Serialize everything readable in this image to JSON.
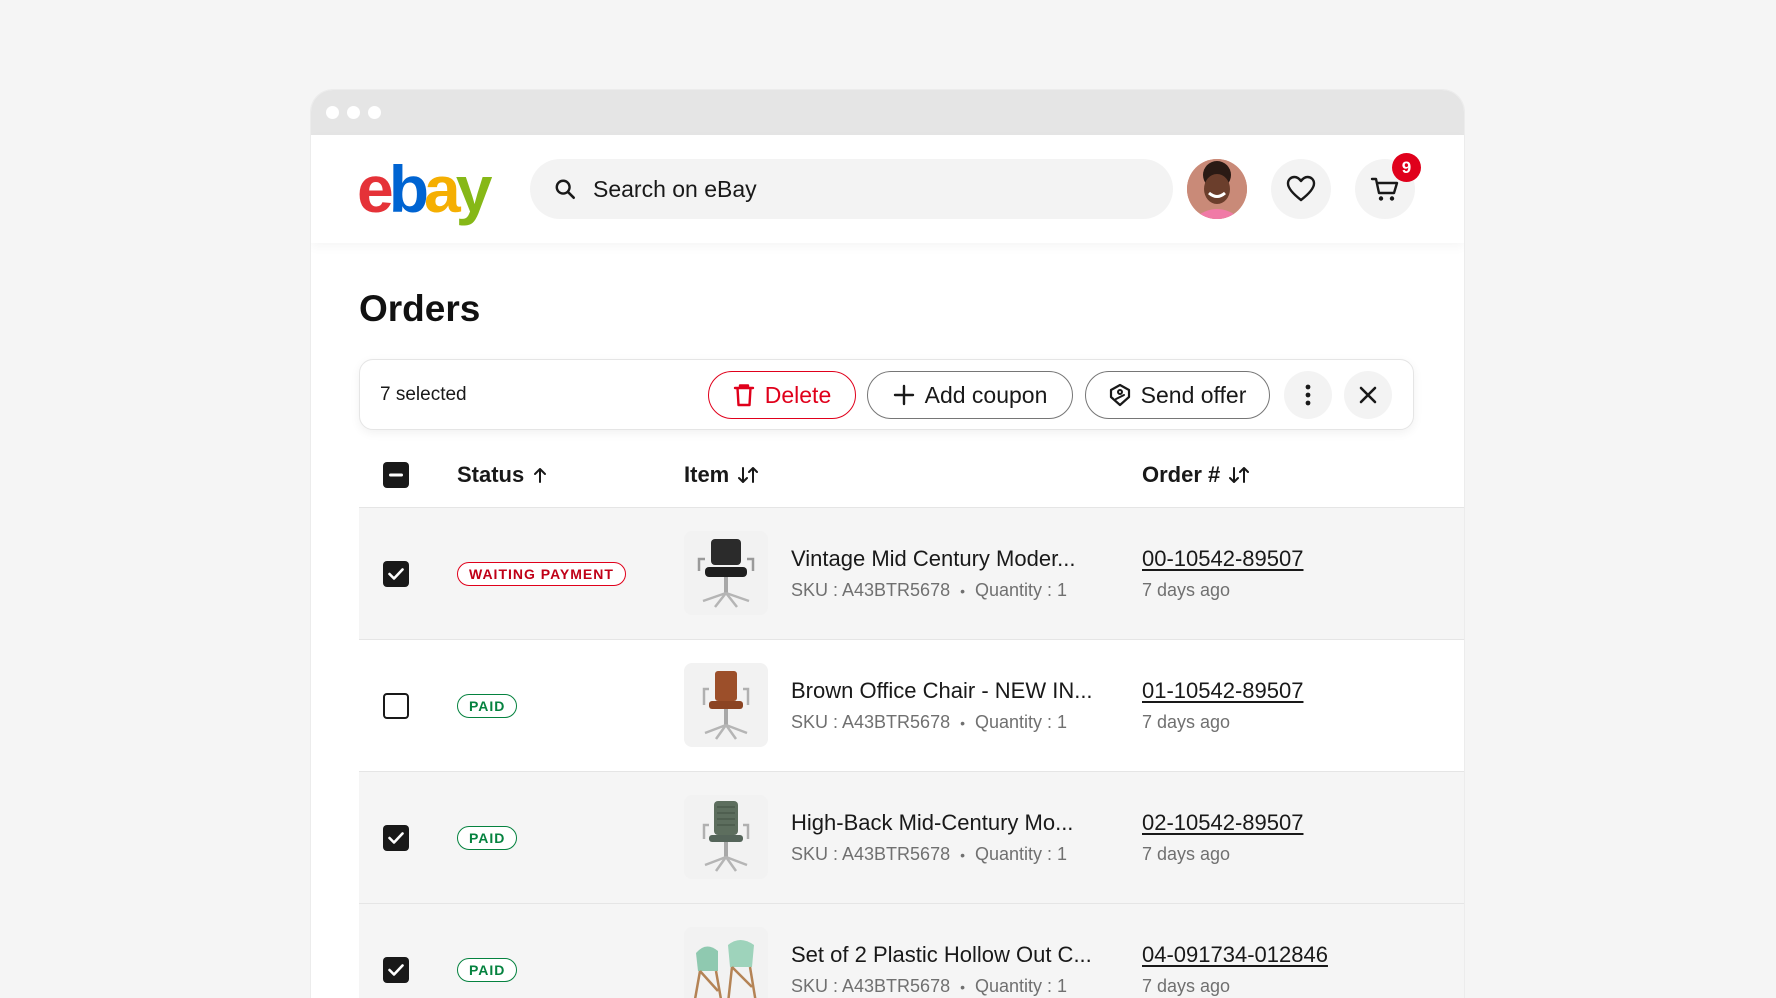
{
  "brand": {
    "logo_letters": [
      "e",
      "b",
      "a",
      "y"
    ],
    "logo_colors": [
      "#e53238",
      "#0064d2",
      "#f5af02",
      "#86b817"
    ]
  },
  "header": {
    "search_placeholder": "Search on eBay",
    "cart_count": "9"
  },
  "page": {
    "title": "Orders"
  },
  "action_bar": {
    "selected_label": "7 selected",
    "delete_label": "Delete",
    "add_coupon_label": "Add coupon",
    "send_offer_label": "Send offer"
  },
  "table": {
    "columns": {
      "status": "Status",
      "item": "Item",
      "order": "Order #"
    },
    "rows": [
      {
        "checked": true,
        "status": "WAITING PAYMENT",
        "status_type": "waiting",
        "title": "Vintage Mid Century Moder...",
        "sku": "SKU : A43BTR5678",
        "quantity": "Quantity : 1",
        "order_number": "00-10542-89507",
        "time": "7 days ago",
        "thumb_icon": "black-office-chair-image"
      },
      {
        "checked": false,
        "status": "PAID",
        "status_type": "paid",
        "title": "Brown Office Chair - NEW IN...",
        "sku": "SKU : A43BTR5678",
        "quantity": "Quantity : 1",
        "order_number": "01-10542-89507",
        "time": "7 days ago",
        "thumb_icon": "brown-office-chair-image"
      },
      {
        "checked": true,
        "status": "PAID",
        "status_type": "paid",
        "title": "High-Back Mid-Century Mo...",
        "sku": "SKU : A43BTR5678",
        "quantity": "Quantity : 1",
        "order_number": "02-10542-89507",
        "time": "7 days ago",
        "thumb_icon": "green-highback-chair-image"
      },
      {
        "checked": true,
        "status": "PAID",
        "status_type": "paid",
        "title": "Set of 2 Plastic Hollow Out C...",
        "sku": "SKU : A43BTR5678",
        "quantity": "Quantity : 1",
        "order_number": "04-091734-012846",
        "time": "7 days ago",
        "thumb_icon": "mint-plastic-chairs-image"
      }
    ]
  },
  "colors": {
    "delete_red": "#e0001b",
    "paid_green": "#05823f",
    "badge_red": "#e0001b"
  }
}
